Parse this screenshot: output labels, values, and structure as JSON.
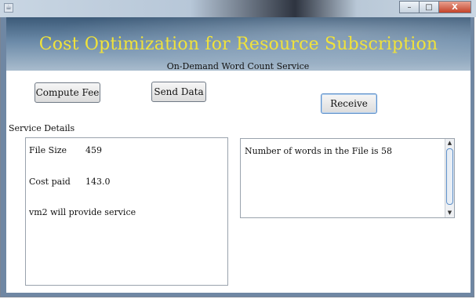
{
  "window": {
    "app_icon": "java-cup-icon",
    "minimize_glyph": "–",
    "maximize_glyph": "□",
    "close_glyph": "X"
  },
  "header": {
    "title": "Cost Optimization for Resource Subscription",
    "subtitle": "On-Demand Word Count Service"
  },
  "toolbar": {
    "compute_fee_label": "Compute Fee",
    "send_data_label": "Send Data",
    "receive_label": "Receive"
  },
  "service_details": {
    "heading": "Service Details",
    "file_size_label": "File Size",
    "file_size_value": "459",
    "cost_paid_label": "Cost paid",
    "cost_paid_value": "143.0",
    "provider_text": "vm2 will provide service"
  },
  "result": {
    "text": "Number of words in the File is 58"
  },
  "colors": {
    "title": "#f0e23a",
    "banner": "#4f6d8c"
  }
}
